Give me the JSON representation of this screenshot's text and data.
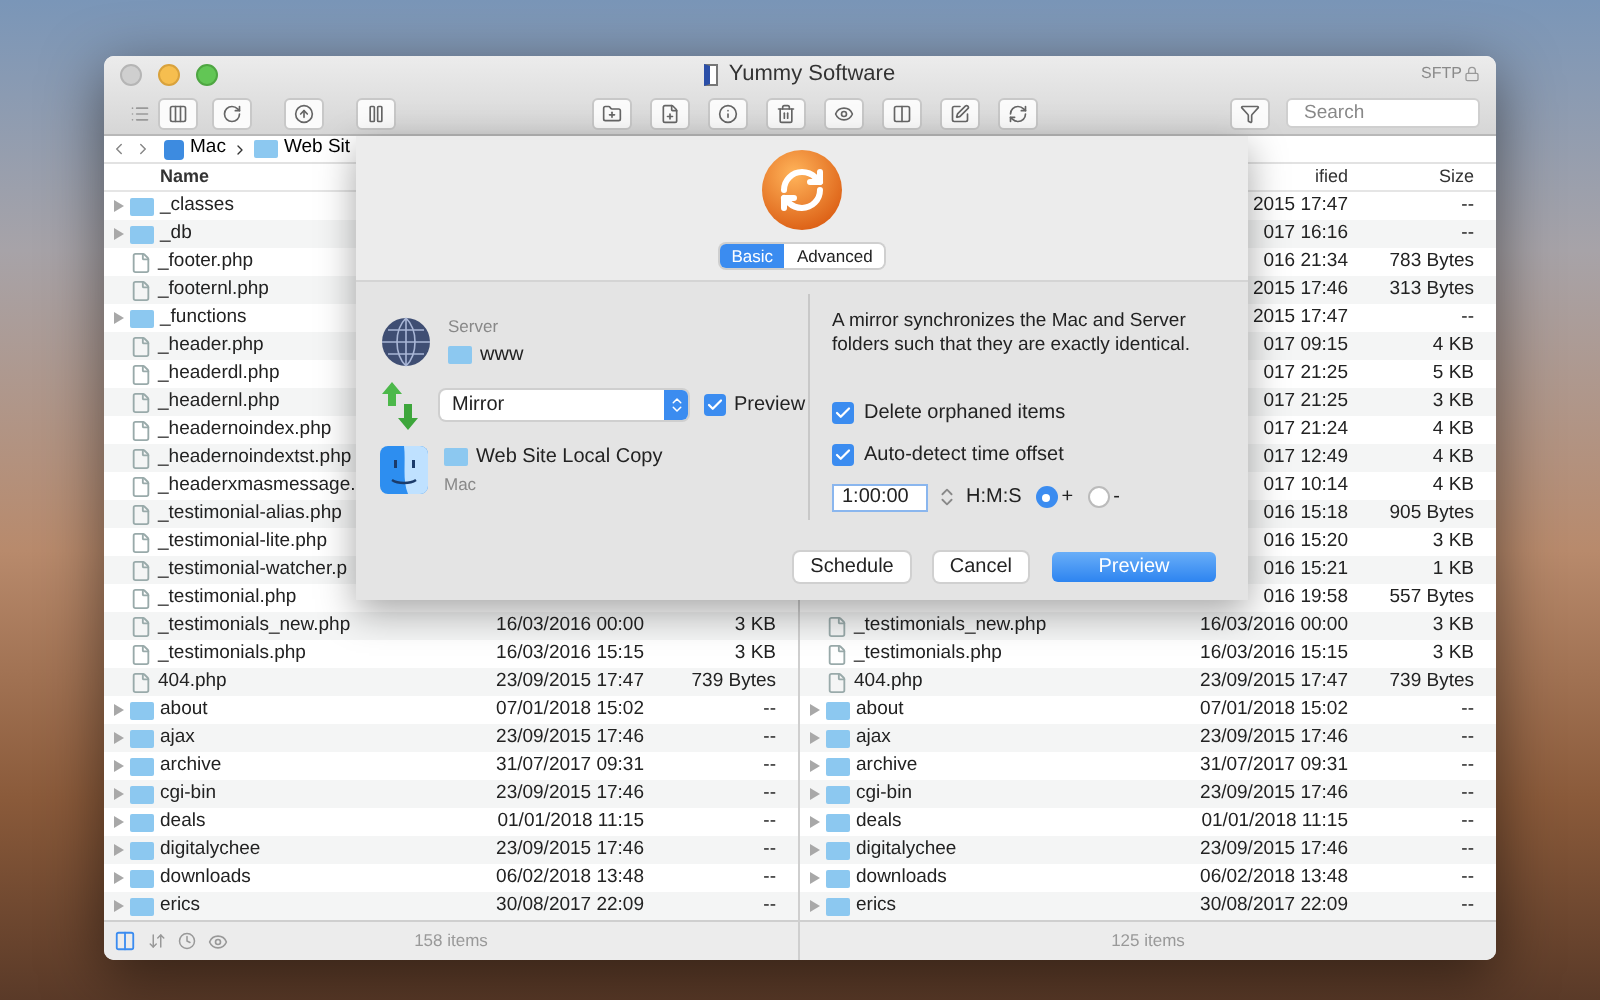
{
  "window": {
    "title": "Yummy Software",
    "protocol": "SFTP"
  },
  "toolbar": {
    "search": {
      "placeholder": "Search"
    }
  },
  "path_bar": {
    "items": [
      "Mac",
      "Web Sit"
    ]
  },
  "left_pane": {
    "columns": [
      "Name"
    ],
    "rows": [
      {
        "name": "_classes",
        "kind": "folder"
      },
      {
        "name": "_db",
        "kind": "folder"
      },
      {
        "name": "_footer.php",
        "kind": "file"
      },
      {
        "name": "_footernl.php",
        "kind": "file"
      },
      {
        "name": "_functions",
        "kind": "folder"
      },
      {
        "name": "_header.php",
        "kind": "file"
      },
      {
        "name": "_headerdl.php",
        "kind": "file"
      },
      {
        "name": "_headernl.php",
        "kind": "file"
      },
      {
        "name": "_headernoindex.php",
        "kind": "file"
      },
      {
        "name": "_headernoindextst.php",
        "kind": "file"
      },
      {
        "name": "_headerxmasmessage.",
        "kind": "file"
      },
      {
        "name": "_testimonial-alias.php",
        "kind": "file"
      },
      {
        "name": "_testimonial-lite.php",
        "kind": "file"
      },
      {
        "name": "_testimonial-watcher.p",
        "kind": "file"
      },
      {
        "name": "_testimonial.php",
        "kind": "file"
      },
      {
        "name": "_testimonials_new.php",
        "kind": "file",
        "modified": "16/03/2016 00:00",
        "size": "3 KB"
      },
      {
        "name": "_testimonials.php",
        "kind": "file",
        "modified": "16/03/2016 15:15",
        "size": "3 KB"
      },
      {
        "name": "404.php",
        "kind": "file",
        "modified": "23/09/2015 17:47",
        "size": "739 Bytes"
      },
      {
        "name": "about",
        "kind": "folder",
        "modified": "07/01/2018 15:02",
        "size": "--"
      },
      {
        "name": "ajax",
        "kind": "folder",
        "modified": "23/09/2015 17:46",
        "size": "--"
      },
      {
        "name": "archive",
        "kind": "folder",
        "modified": "31/07/2017 09:31",
        "size": "--"
      },
      {
        "name": "cgi-bin",
        "kind": "folder",
        "modified": "23/09/2015 17:46",
        "size": "--"
      },
      {
        "name": "deals",
        "kind": "folder",
        "modified": "01/01/2018 11:15",
        "size": "--"
      },
      {
        "name": "digitalychee",
        "kind": "folder",
        "modified": "23/09/2015 17:46",
        "size": "--"
      },
      {
        "name": "downloads",
        "kind": "folder",
        "modified": "06/02/2018 13:48",
        "size": "--"
      },
      {
        "name": "erics",
        "kind": "folder",
        "modified": "30/08/2017 22:09",
        "size": "--"
      }
    ],
    "status": "158 items"
  },
  "right_pane": {
    "columns": [
      "ified",
      "Size"
    ],
    "rows": [
      {
        "modified": "2015 17:47",
        "size": "--"
      },
      {
        "modified": "017 16:16",
        "size": "--"
      },
      {
        "modified": "016 21:34",
        "size": "783 Bytes"
      },
      {
        "modified": "2015 17:46",
        "size": "313 Bytes"
      },
      {
        "modified": "2015 17:47",
        "size": "--"
      },
      {
        "modified": "017 09:15",
        "size": "4 KB"
      },
      {
        "modified": "017 21:25",
        "size": "5 KB"
      },
      {
        "modified": "017 21:25",
        "size": "3 KB"
      },
      {
        "modified": "017 21:24",
        "size": "4 KB"
      },
      {
        "modified": "017 12:49",
        "size": "4 KB"
      },
      {
        "modified": "017 10:14",
        "size": "4 KB"
      },
      {
        "modified": "016 15:18",
        "size": "905 Bytes"
      },
      {
        "modified": "016 15:20",
        "size": "3 KB"
      },
      {
        "modified": "016 15:21",
        "size": "1 KB"
      },
      {
        "modified": "016 19:58",
        "size": "557 Bytes"
      },
      {
        "name": "_testimonials_new.php",
        "kind": "file",
        "modified": "16/03/2016 00:00",
        "size": "3 KB"
      },
      {
        "name": "_testimonials.php",
        "kind": "file",
        "modified": "16/03/2016 15:15",
        "size": "3 KB"
      },
      {
        "name": "404.php",
        "kind": "file",
        "modified": "23/09/2015 17:47",
        "size": "739 Bytes"
      },
      {
        "name": "about",
        "kind": "folder",
        "modified": "07/01/2018 15:02",
        "size": "--"
      },
      {
        "name": "ajax",
        "kind": "folder",
        "modified": "23/09/2015 17:46",
        "size": "--"
      },
      {
        "name": "archive",
        "kind": "folder",
        "modified": "31/07/2017 09:31",
        "size": "--"
      },
      {
        "name": "cgi-bin",
        "kind": "folder",
        "modified": "23/09/2015 17:46",
        "size": "--"
      },
      {
        "name": "deals",
        "kind": "folder",
        "modified": "01/01/2018 11:15",
        "size": "--"
      },
      {
        "name": "digitalychee",
        "kind": "folder",
        "modified": "23/09/2015 17:46",
        "size": "--"
      },
      {
        "name": "downloads",
        "kind": "folder",
        "modified": "06/02/2018 13:48",
        "size": "--"
      },
      {
        "name": "erics",
        "kind": "folder",
        "modified": "30/08/2017 22:09",
        "size": "--"
      }
    ],
    "status": "125 items"
  },
  "sheet": {
    "tabs": [
      {
        "label": "Basic",
        "selected": true
      },
      {
        "label": "Advanced",
        "selected": false
      }
    ],
    "server_label": "Server",
    "server_folder": "www",
    "mode": "Mirror",
    "preview": {
      "label": "Preview",
      "checked": true
    },
    "local_folder": "Web Site Local Copy",
    "local_label": "Mac",
    "description": "A mirror synchronizes the Mac and Server folders such that they are exactly identical.",
    "options": [
      {
        "label": "Delete orphaned items",
        "checked": true
      },
      {
        "label": "Auto-detect time offset",
        "checked": true
      }
    ],
    "time_offset": {
      "value": "1:00:00",
      "unit": "H:M:S",
      "signs": [
        {
          "label": "+",
          "selected": true
        },
        {
          "label": "-",
          "selected": false
        }
      ]
    },
    "buttons": [
      {
        "label": "Schedule",
        "kind": "normal"
      },
      {
        "label": "Cancel",
        "kind": "normal"
      },
      {
        "label": "Preview",
        "kind": "default"
      }
    ]
  }
}
